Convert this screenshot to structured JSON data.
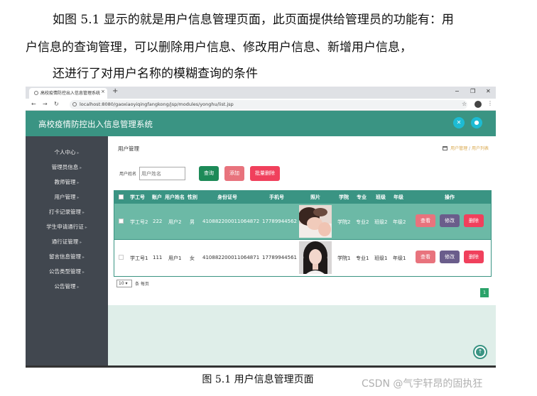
{
  "document": {
    "para1": "如图 5.1 显示的就是用户信息管理页面，此页面提供给管理员的功能有：用",
    "para2": "户信息的查询管理，可以删除用户信息、修改用户信息、新增用户信息，",
    "para3": "还进行了对用户名称的模糊查询的条件",
    "caption": "图 5.1  用户信息管理页面",
    "watermark": "CSDN @气宇轩昂的固执狂"
  },
  "browser": {
    "tab_title": "高校疫情防控出入信息管理系统",
    "tab_close": "×",
    "new_tab": "+",
    "url": "localhost:8080/gaoxiaoyiqingfangkong/jsp/modules/yonghu/list.jsp",
    "minimize": "−",
    "restore": "❐",
    "close": "✕"
  },
  "app": {
    "title": "高校疫情防控出入信息管理系统"
  },
  "sidebar": {
    "items": [
      "个人中心",
      "管理员信息",
      "教师管理",
      "用户管理",
      "打卡记录管理",
      "学生申请通行证",
      "通行证管理",
      "留言信息管理",
      "公告类型管理",
      "公告管理"
    ]
  },
  "page": {
    "title": "用户管理",
    "breadcrumb": [
      "用户管理",
      "用户列表"
    ]
  },
  "search": {
    "label": "用户姓名",
    "placeholder": "用户姓名",
    "query_label": "查询",
    "add_label": "添加",
    "batch_delete_label": "批量删除"
  },
  "table": {
    "headers": [
      "学工号",
      "账户",
      "用户姓名",
      "性别",
      "身份证号",
      "手机号",
      "照片",
      "学院",
      "专业",
      "班级",
      "年级",
      "操作"
    ],
    "rows": [
      {
        "student_id": "学工号2",
        "account": "222",
        "name": "用户2",
        "gender": "男",
        "id_card": "410882200011064872",
        "phone": "17789944562",
        "college": "学院2",
        "major": "专业2",
        "class": "班级2",
        "grade": "年级2"
      },
      {
        "student_id": "学工号1",
        "account": "111",
        "name": "用户1",
        "gender": "女",
        "id_card": "410882200011064871",
        "phone": "17789944561",
        "college": "学院1",
        "major": "专业1",
        "class": "班级1",
        "grade": "年级1"
      }
    ],
    "actions": {
      "view": "查看",
      "edit": "修改",
      "delete": "删除"
    }
  },
  "pagination": {
    "page_size": "10",
    "page_size_suffix": "条 每页",
    "current_page": "1"
  },
  "colors": {
    "header": "#3a9483",
    "sidebar": "#41474f",
    "view": "#e8737d",
    "edit": "#6a5d8b",
    "delete": "#f0405c"
  }
}
